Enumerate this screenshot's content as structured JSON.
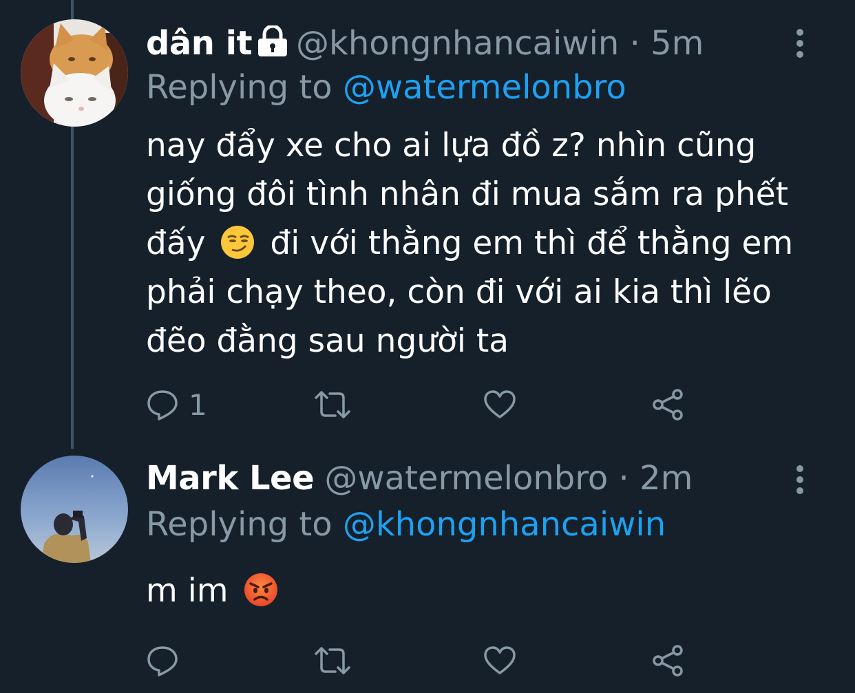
{
  "colors": {
    "background": "#15202b",
    "text_primary": "#ffffff",
    "text_secondary": "#8899a6",
    "mention": "#1da1f2",
    "thread_line": "#3d5466"
  },
  "tweets": [
    {
      "display_name": "dân it",
      "protected_icon": "lock-icon",
      "handle": "@khongnhancaiwin",
      "separator": "·",
      "time": "5m",
      "replying_prefix": "Replying to",
      "replying_to": "@watermelonbro",
      "text_part1": "nay đẩy xe cho ai lựa đồ z? nhìn cũng giống đôi tình nhân đi mua sắm ra phết đấy",
      "emoji": "smirking-face-emoji",
      "text_part2": "đi với thằng em thì để thằng em phải chạy theo, còn đi với ai kia thì lẽo đẽo đằng sau người ta",
      "reply_count": "1",
      "avatar": "cats-avatar"
    },
    {
      "display_name": "Mark Lee",
      "handle": "@watermelonbro",
      "separator": "·",
      "time": "2m",
      "replying_prefix": "Replying to",
      "replying_to": "@khongnhancaiwin",
      "text_part1": "m im",
      "emoji": "angry-face-emoji",
      "reply_count": "",
      "avatar": "person-sky-avatar"
    }
  ]
}
